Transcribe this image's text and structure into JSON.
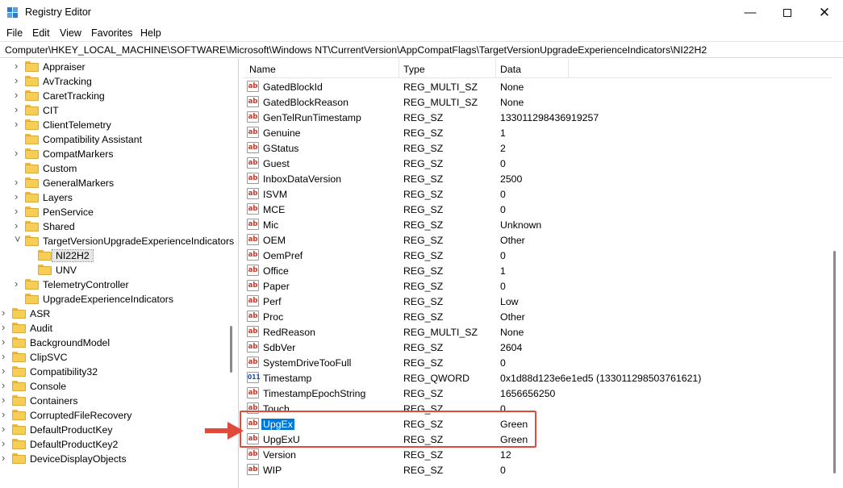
{
  "window": {
    "title": "Registry Editor"
  },
  "menu": [
    "File",
    "Edit",
    "View",
    "Favorites",
    "Help"
  ],
  "address": "Computer\\HKEY_LOCAL_MACHINE\\SOFTWARE\\Microsoft\\Windows NT\\CurrentVersion\\AppCompatFlags\\TargetVersionUpgradeExperienceIndicators\\NI22H2",
  "tree": [
    "Appraiser",
    "AvTracking",
    "CaretTracking",
    "CIT",
    "ClientTelemetry",
    "Compatibility Assistant",
    "CompatMarkers",
    "Custom",
    "GeneralMarkers",
    "Layers",
    "PenService",
    "Shared",
    "TargetVersionUpgradeExperienceIndicators",
    "NI22H2",
    "UNV",
    "TelemetryController",
    "UpgradeExperienceIndicators",
    "ASR",
    "Audit",
    "BackgroundModel",
    "ClipSVC",
    "Compatibility32",
    "Console",
    "Containers",
    "CorruptedFileRecovery",
    "DefaultProductKey",
    "DefaultProductKey2",
    "DeviceDisplayObjects"
  ],
  "columns": {
    "name": "Name",
    "type": "Type",
    "data": "Data"
  },
  "values": [
    [
      "GatedBlockId",
      "REG_MULTI_SZ",
      "None"
    ],
    [
      "GatedBlockReason",
      "REG_MULTI_SZ",
      "None"
    ],
    [
      "GenTelRunTimestamp",
      "REG_SZ",
      "133011298436919257"
    ],
    [
      "Genuine",
      "REG_SZ",
      "1"
    ],
    [
      "GStatus",
      "REG_SZ",
      "2"
    ],
    [
      "Guest",
      "REG_SZ",
      "0"
    ],
    [
      "InboxDataVersion",
      "REG_SZ",
      "2500"
    ],
    [
      "ISVM",
      "REG_SZ",
      "0"
    ],
    [
      "MCE",
      "REG_SZ",
      "0"
    ],
    [
      "Mic",
      "REG_SZ",
      "Unknown"
    ],
    [
      "OEM",
      "REG_SZ",
      "Other"
    ],
    [
      "OemPref",
      "REG_SZ",
      "0"
    ],
    [
      "Office",
      "REG_SZ",
      "1"
    ],
    [
      "Paper",
      "REG_SZ",
      "0"
    ],
    [
      "Perf",
      "REG_SZ",
      "Low"
    ],
    [
      "Proc",
      "REG_SZ",
      "Other"
    ],
    [
      "RedReason",
      "REG_MULTI_SZ",
      "None"
    ],
    [
      "SdbVer",
      "REG_SZ",
      "2604"
    ],
    [
      "SystemDriveTooFull",
      "REG_SZ",
      "0"
    ],
    [
      "Timestamp",
      "REG_QWORD",
      "0x1d88d123e6e1ed5 (133011298503761621)"
    ],
    [
      "TimestampEpochString",
      "REG_SZ",
      "1656656250"
    ],
    [
      "Touch",
      "REG_SZ",
      "0"
    ],
    [
      "UpgEx",
      "REG_SZ",
      "Green"
    ],
    [
      "UpgExU",
      "REG_SZ",
      "Green"
    ],
    [
      "Version",
      "REG_SZ",
      "12"
    ],
    [
      "WIP",
      "REG_SZ",
      "0"
    ]
  ],
  "icons": {
    "string": "ab",
    "binary": "011"
  },
  "colors": {
    "selection": "#0078d7",
    "annotation": "#e04a3a",
    "folder": "#f6cd55"
  }
}
